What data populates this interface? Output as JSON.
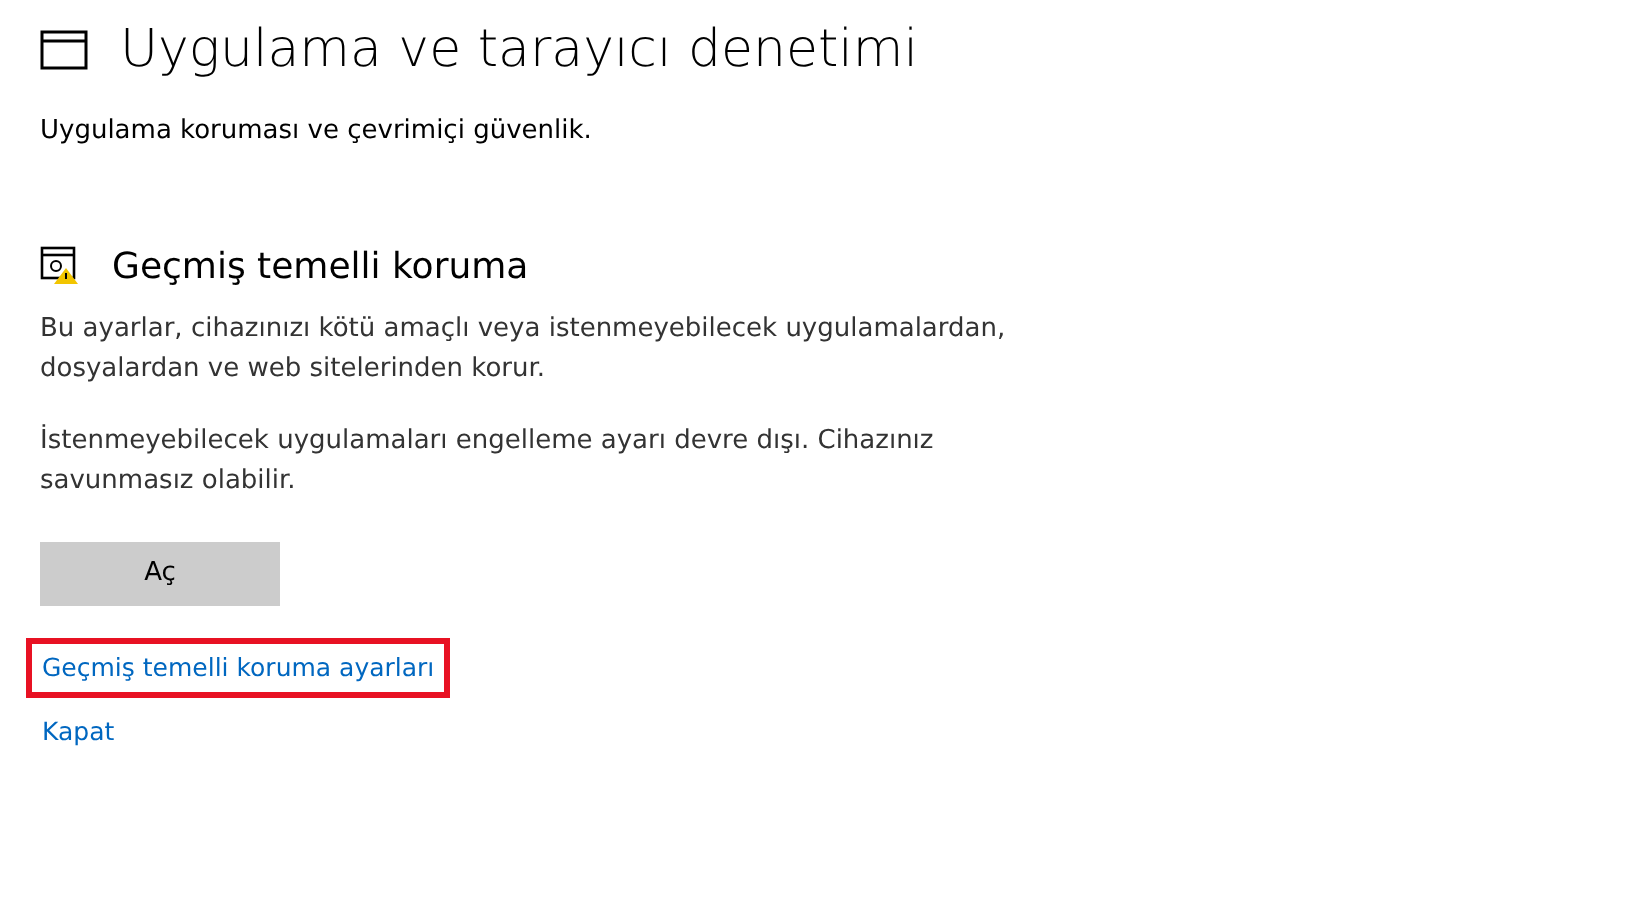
{
  "page": {
    "title": "Uygulama ve tarayıcı denetimi",
    "subtitle": "Uygulama koruması ve çevrimiçi güvenlik."
  },
  "section": {
    "heading": "Geçmiş temelli koruma",
    "warning": true,
    "paragraphs": [
      "Bu ayarlar, cihazınızı kötü amaçlı veya istenmeyebilecek uygulamalardan, dosyalardan ve web sitelerinden korur.",
      "İstenmeyebilecek uygulamaları engelleme ayarı devre dışı. Cihazınız savunmasız olabilir."
    ],
    "button": "Aç",
    "links": [
      {
        "label": "Geçmiş temelli koruma ayarları",
        "highlighted": true
      },
      {
        "label": "Kapat",
        "highlighted": false
      }
    ]
  }
}
